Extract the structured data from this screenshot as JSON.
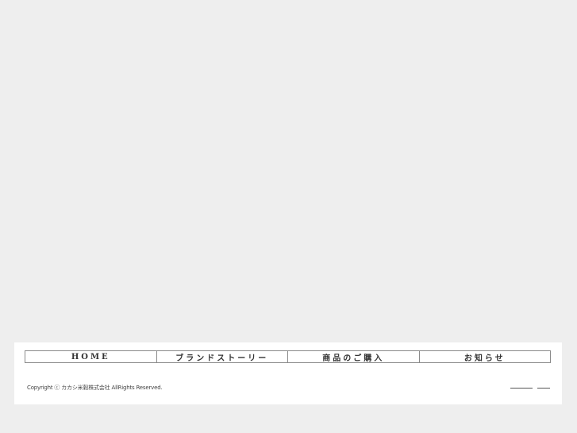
{
  "nav": {
    "items": [
      {
        "label": "HOME"
      },
      {
        "label": "ブランドストーリー"
      },
      {
        "label": "商品のご購入"
      },
      {
        "label": "お知らせ"
      }
    ]
  },
  "footer": {
    "copyright": "Copyright ⓒ カカシ米穀株式会社 AllRights Reserved."
  },
  "icons": {
    "social_1": "line-icon",
    "social_2": "line-icon"
  },
  "colors": {
    "background": "#eeeeee",
    "footer_bg": "#ffffff",
    "border": "#8a8a8a",
    "text": "#333333"
  }
}
